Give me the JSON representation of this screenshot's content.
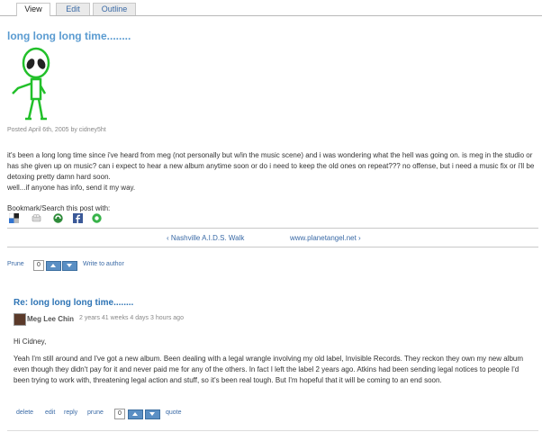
{
  "tabs": [
    {
      "label": "View",
      "active": true
    },
    {
      "label": "Edit",
      "active": false
    },
    {
      "label": "Outline",
      "active": false
    }
  ],
  "post": {
    "title": "long long long time........",
    "meta": "Posted April 6th, 2005 by cidney5ht",
    "paragraphs": [
      "it's been a long long time since i've heard from meg (not personally but w/in the music scene) and i was wondering what the hell was going on. is meg in the studio or has she given up on music? can i expect to hear a new album anytime soon or do i need to keep the old ones on repeat??? no offense, but i need a music fix or i'll be detoxing pretty damn hard soon.",
      "well...if anyone has info, send it my way."
    ],
    "image_icon": "green-alien-icon"
  },
  "bookmarks": {
    "label": "Bookmark/Search this post with:",
    "icons": [
      "delicious-icon",
      "digg-icon",
      "stumbleupon-icon",
      "facebook-icon",
      "technorati-icon"
    ]
  },
  "book_nav": {
    "prev": "‹ Nashville A.I.D.S. Walk",
    "next": "www.planetangel.net ›"
  },
  "post_actions": {
    "prune": "Prune",
    "votes": "0",
    "write": "Write to author"
  },
  "comment": {
    "title": "Re: long long long time........",
    "author": "Meg Lee Chin",
    "time": "2 years 41 weeks 4 days 3 hours ago",
    "paragraphs": [
      "Hi Cidney,",
      "Yeah I'm still around and I've got a new album. Been dealing with a legal wrangle involving my old label, Invisible Records. They reckon they own my new album even though they didn't pay for it and never paid me for any of the others. In fact I left the label 2 years ago. Atkins had been sending legal notices to people I'd been trying to work with, threatening legal action and stuff, so it's been real tough. But I'm hopeful that it will be coming to an end soon."
    ],
    "actions": {
      "delete": "delete",
      "edit": "edit",
      "reply": "reply",
      "prune": "prune",
      "votes": "0",
      "quote": "quote"
    }
  },
  "colors": {
    "link": "#3a6aa6",
    "title": "#5a9bd1",
    "vote": "#5a8fc4"
  }
}
